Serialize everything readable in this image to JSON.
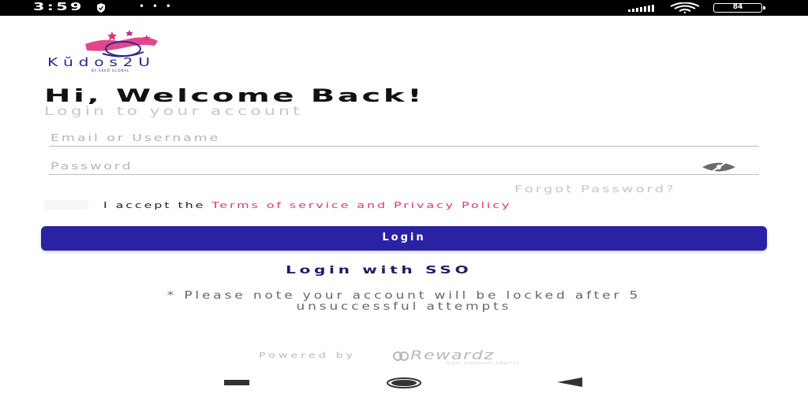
{
  "status_bar": {
    "time": "3:59",
    "dots": "• • •",
    "battery": "84"
  },
  "brand": {
    "name": "Kŭdos2U",
    "tagline": "BY EEED GLOBAL",
    "primary_color": "#2a22a3",
    "accent_color": "#e0337e"
  },
  "header": {
    "title": "Hi, Welcome Back!",
    "subtitle": "Login to your account"
  },
  "form": {
    "email_placeholder": "Email or Username",
    "password_placeholder": "Password",
    "forgot_password": "Forgot Password?",
    "terms_prefix": "I accept the ",
    "terms_link": "Terms of service and Privacy Policy",
    "terms_checked": false,
    "login_label": "Login",
    "sso_label": "Login with SSO"
  },
  "notice": {
    "line1": "* Please note your account will be locked after 5",
    "line2": "unsuccessful attempts"
  },
  "footer": {
    "powered_by": "Powered by",
    "provider": "Rewardz",
    "provider_tagline": "Digital Engagement, Simplified"
  },
  "icons": {
    "status_shield": "shield-icon",
    "signal": "signal-icon",
    "wifi": "wifi-icon",
    "battery": "battery-icon",
    "password_toggle": "eye-off-icon",
    "nav_recents": "recents-icon",
    "nav_home": "home-icon",
    "nav_back": "back-icon"
  }
}
